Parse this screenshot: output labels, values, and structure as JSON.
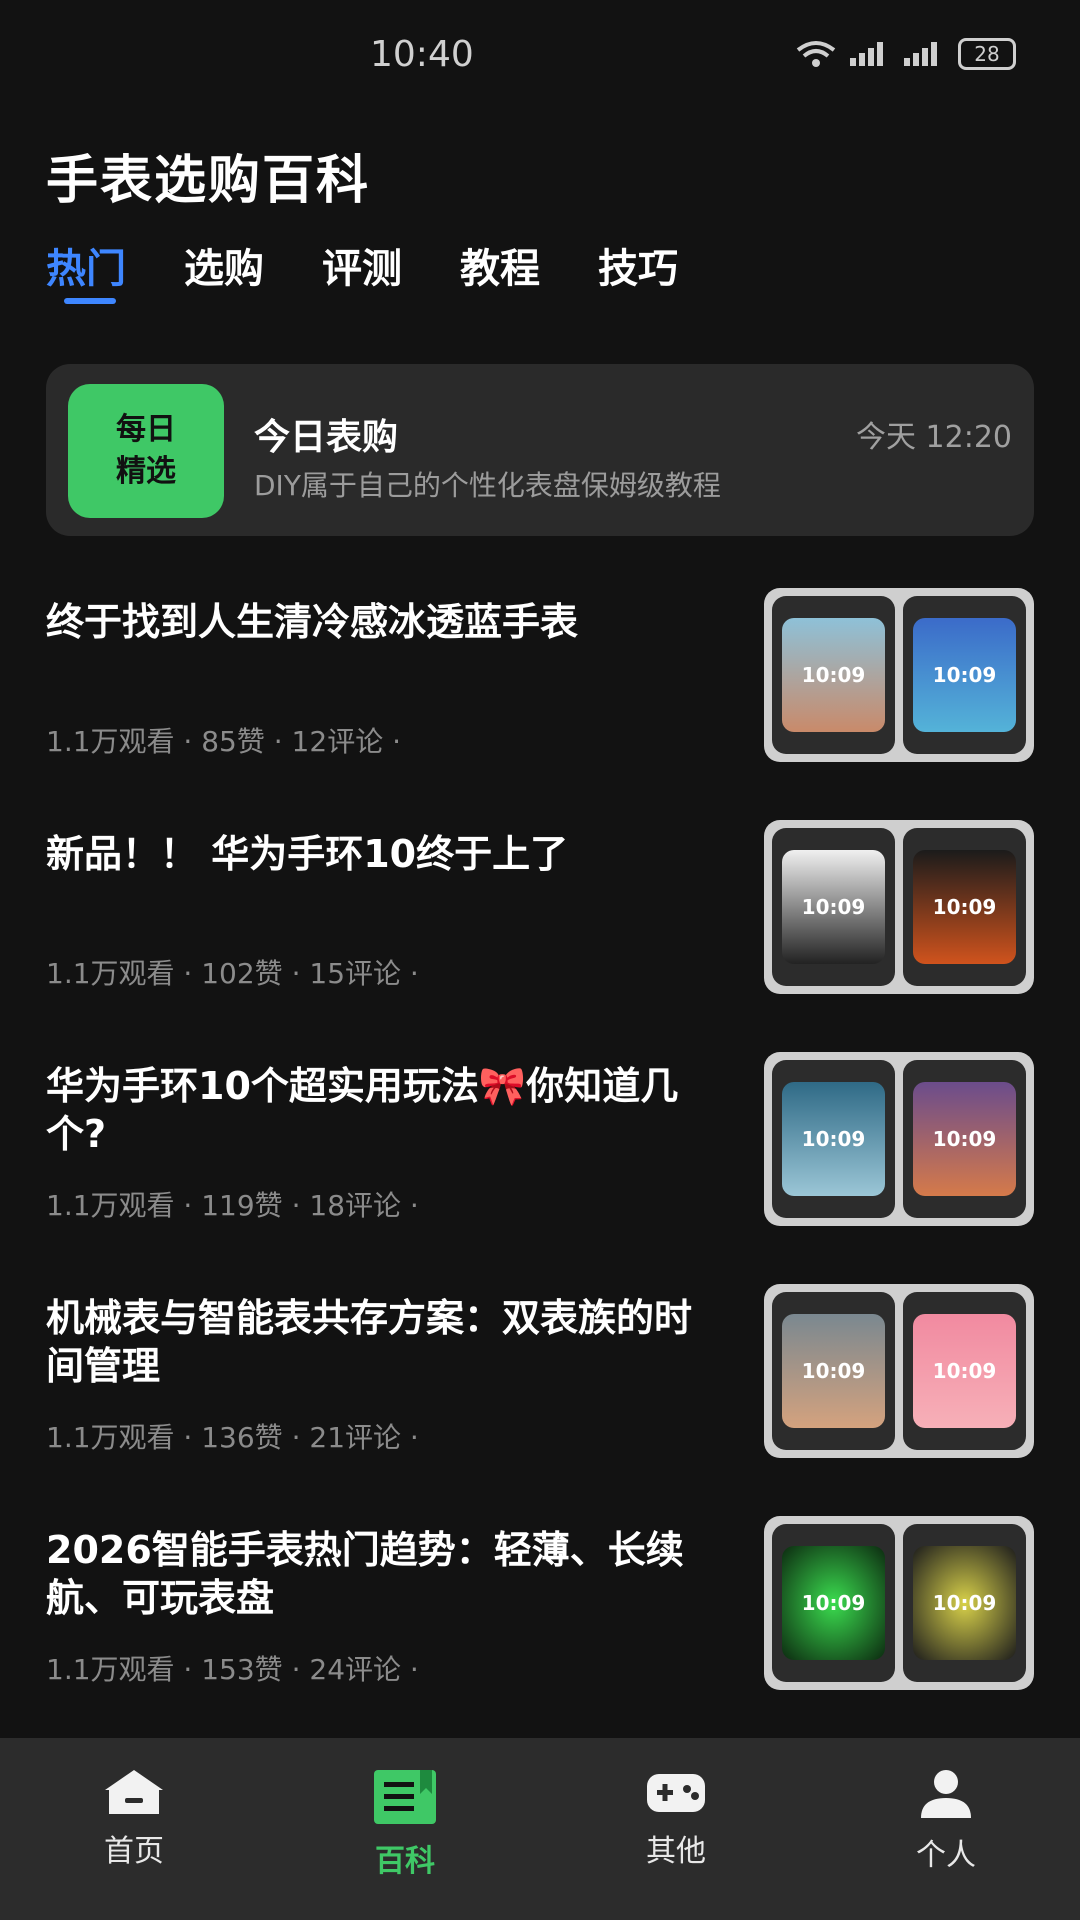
{
  "status": {
    "time": "10:40",
    "battery": "28"
  },
  "header": {
    "title": "手表选购百科"
  },
  "tabs": [
    {
      "label": "热门",
      "active": true
    },
    {
      "label": "选购",
      "active": false
    },
    {
      "label": "评测",
      "active": false
    },
    {
      "label": "教程",
      "active": false
    },
    {
      "label": "技巧",
      "active": false
    }
  ],
  "banner": {
    "badge_line1": "每日",
    "badge_line2": "精选",
    "title": "今日表购",
    "subtitle": "DIY属于自己的个性化表盘保姆级教程",
    "time": "今天 12:20"
  },
  "articles": [
    {
      "title": "终于找到人生清冷感冰透蓝手表",
      "meta": "1.1万观看 · 85赞 · 12评论 ·",
      "thumb": {
        "left": "10:09",
        "right": "10:09"
      }
    },
    {
      "title": "新品！！ 华为手环10终于上了",
      "meta": "1.1万观看 · 102赞 · 15评论 ·",
      "thumb": {
        "left": "10:09",
        "right": "10:09"
      }
    },
    {
      "title": "华为手环10个超实用玩法🎀你知道几个?",
      "meta": "1.1万观看 · 119赞 · 18评论 ·",
      "thumb": {
        "left": "10:09",
        "right": "10:09"
      }
    },
    {
      "title": "机械表与智能表共存方案：双表族的时间管理",
      "meta": "1.1万观看 · 136赞 · 21评论 ·",
      "thumb": {
        "left": "10:09",
        "right": "10:09"
      }
    },
    {
      "title": "2026智能手表热门趋势：轻薄、长续航、可玩表盘",
      "meta": "1.1万观看 · 153赞 · 24评论 ·",
      "thumb": {
        "left": "10:09",
        "right": "10:09"
      }
    }
  ],
  "nav": [
    {
      "label": "首页",
      "icon": "home-icon"
    },
    {
      "label": "百科",
      "icon": "book-icon",
      "active": true
    },
    {
      "label": "其他",
      "icon": "gamepad-icon"
    },
    {
      "label": "个人",
      "icon": "user-icon"
    }
  ],
  "colors": {
    "accent_blue": "#3e86ff",
    "accent_green": "#3fc866",
    "background": "#121212"
  }
}
